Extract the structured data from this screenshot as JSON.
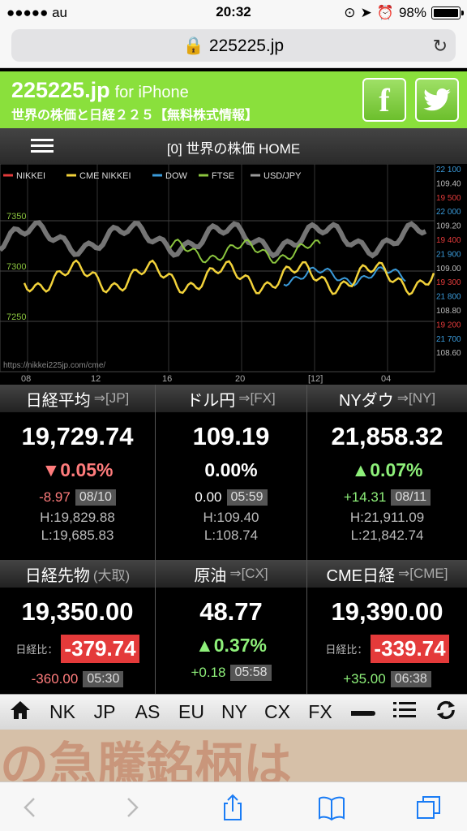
{
  "status": {
    "carrier": "●●●●● au",
    "time": "20:32",
    "battery": "98%"
  },
  "browser": {
    "url": "225225.jp"
  },
  "site": {
    "title": "225225.jp",
    "title_sub": "for iPhone",
    "tagline": "世界の株価と日経２２５【無料株式情報】",
    "facebook": "f"
  },
  "nav": {
    "title": "[0] 世界の株価 HOME"
  },
  "chart_data": {
    "type": "line",
    "series": [
      {
        "name": "NIKKEI",
        "color": "#e23a3a"
      },
      {
        "name": "CME NIKKEI",
        "color": "#f2d23a"
      },
      {
        "name": "DOW",
        "color": "#3a9ad9"
      },
      {
        "name": "FTSE",
        "color": "#8cc63f"
      },
      {
        "name": "USD/JPY",
        "color": "#9a9a9a"
      }
    ],
    "left_ticks": [
      "7350",
      "7300",
      "7250"
    ],
    "right_ticks": [
      {
        "label": "22 100",
        "color": "#3a9ad9"
      },
      {
        "label": "109.40",
        "color": "#bbbbbb"
      },
      {
        "label": "19 500",
        "color": "#e23a3a"
      },
      {
        "label": "22 000",
        "color": "#3a9ad9"
      },
      {
        "label": "109.20",
        "color": "#bbbbbb"
      },
      {
        "label": "19 400",
        "color": "#e23a3a"
      },
      {
        "label": "21 900",
        "color": "#3a9ad9"
      },
      {
        "label": "109.00",
        "color": "#bbbbbb"
      },
      {
        "label": "19 300",
        "color": "#e23a3a"
      },
      {
        "label": "21 800",
        "color": "#3a9ad9"
      },
      {
        "label": "108.80",
        "color": "#bbbbbb"
      },
      {
        "label": "19 200",
        "color": "#e23a3a"
      },
      {
        "label": "21 700",
        "color": "#3a9ad9"
      },
      {
        "label": "108.60",
        "color": "#bbbbbb"
      }
    ],
    "x_ticks": [
      "08",
      "12",
      "16",
      "20",
      "[12]",
      "04"
    ],
    "source": "https://nikkei225jp.com/cme/"
  },
  "cards_row1": [
    {
      "name": "日経平均",
      "link": "⇒[JP]",
      "value": "19,729.74",
      "pct": "▼0.05%",
      "pct_color": "red",
      "change": "-8.97",
      "change_color": "red",
      "date": "08/10",
      "high": "H:19,829.88",
      "low": "L:19,685.83"
    },
    {
      "name": "ドル円",
      "link": "⇒[FX]",
      "value": "109.19",
      "pct": "0.00%",
      "pct_color": "white",
      "change": "0.00",
      "change_color": "white",
      "date": "05:59",
      "high": "H:109.40",
      "low": "L:108.74"
    },
    {
      "name": "NYダウ",
      "link": "⇒[NY]",
      "value": "21,858.32",
      "pct": "▲0.07%",
      "pct_color": "green",
      "change": "+14.31",
      "change_color": "green",
      "date": "08/11",
      "high": "H:21,911.09",
      "low": "L:21,842.74"
    }
  ],
  "cards_row2": [
    {
      "name": "日経先物",
      "link": "(大取)",
      "value": "19,350.00",
      "ratio_label": "日経比：",
      "ratio": "-379.74",
      "change": "-360.00",
      "change_color": "red",
      "date": "05:30"
    },
    {
      "name": "原油",
      "link": "⇒[CX]",
      "value": "48.77",
      "pct": "▲0.37%",
      "pct_color": "green",
      "change": "+0.18",
      "change_color": "green",
      "date": "05:58"
    },
    {
      "name": "CME日経",
      "link": "⇒[CME]",
      "value": "19,390.00",
      "ratio_label": "日経比：",
      "ratio": "-339.74",
      "change": "+35.00",
      "change_color": "green",
      "date": "06:38"
    }
  ],
  "tabs": [
    "NK",
    "JP",
    "AS",
    "EU",
    "NY",
    "CX",
    "FX"
  ],
  "banner": {
    "text": "の急騰銘柄は"
  }
}
